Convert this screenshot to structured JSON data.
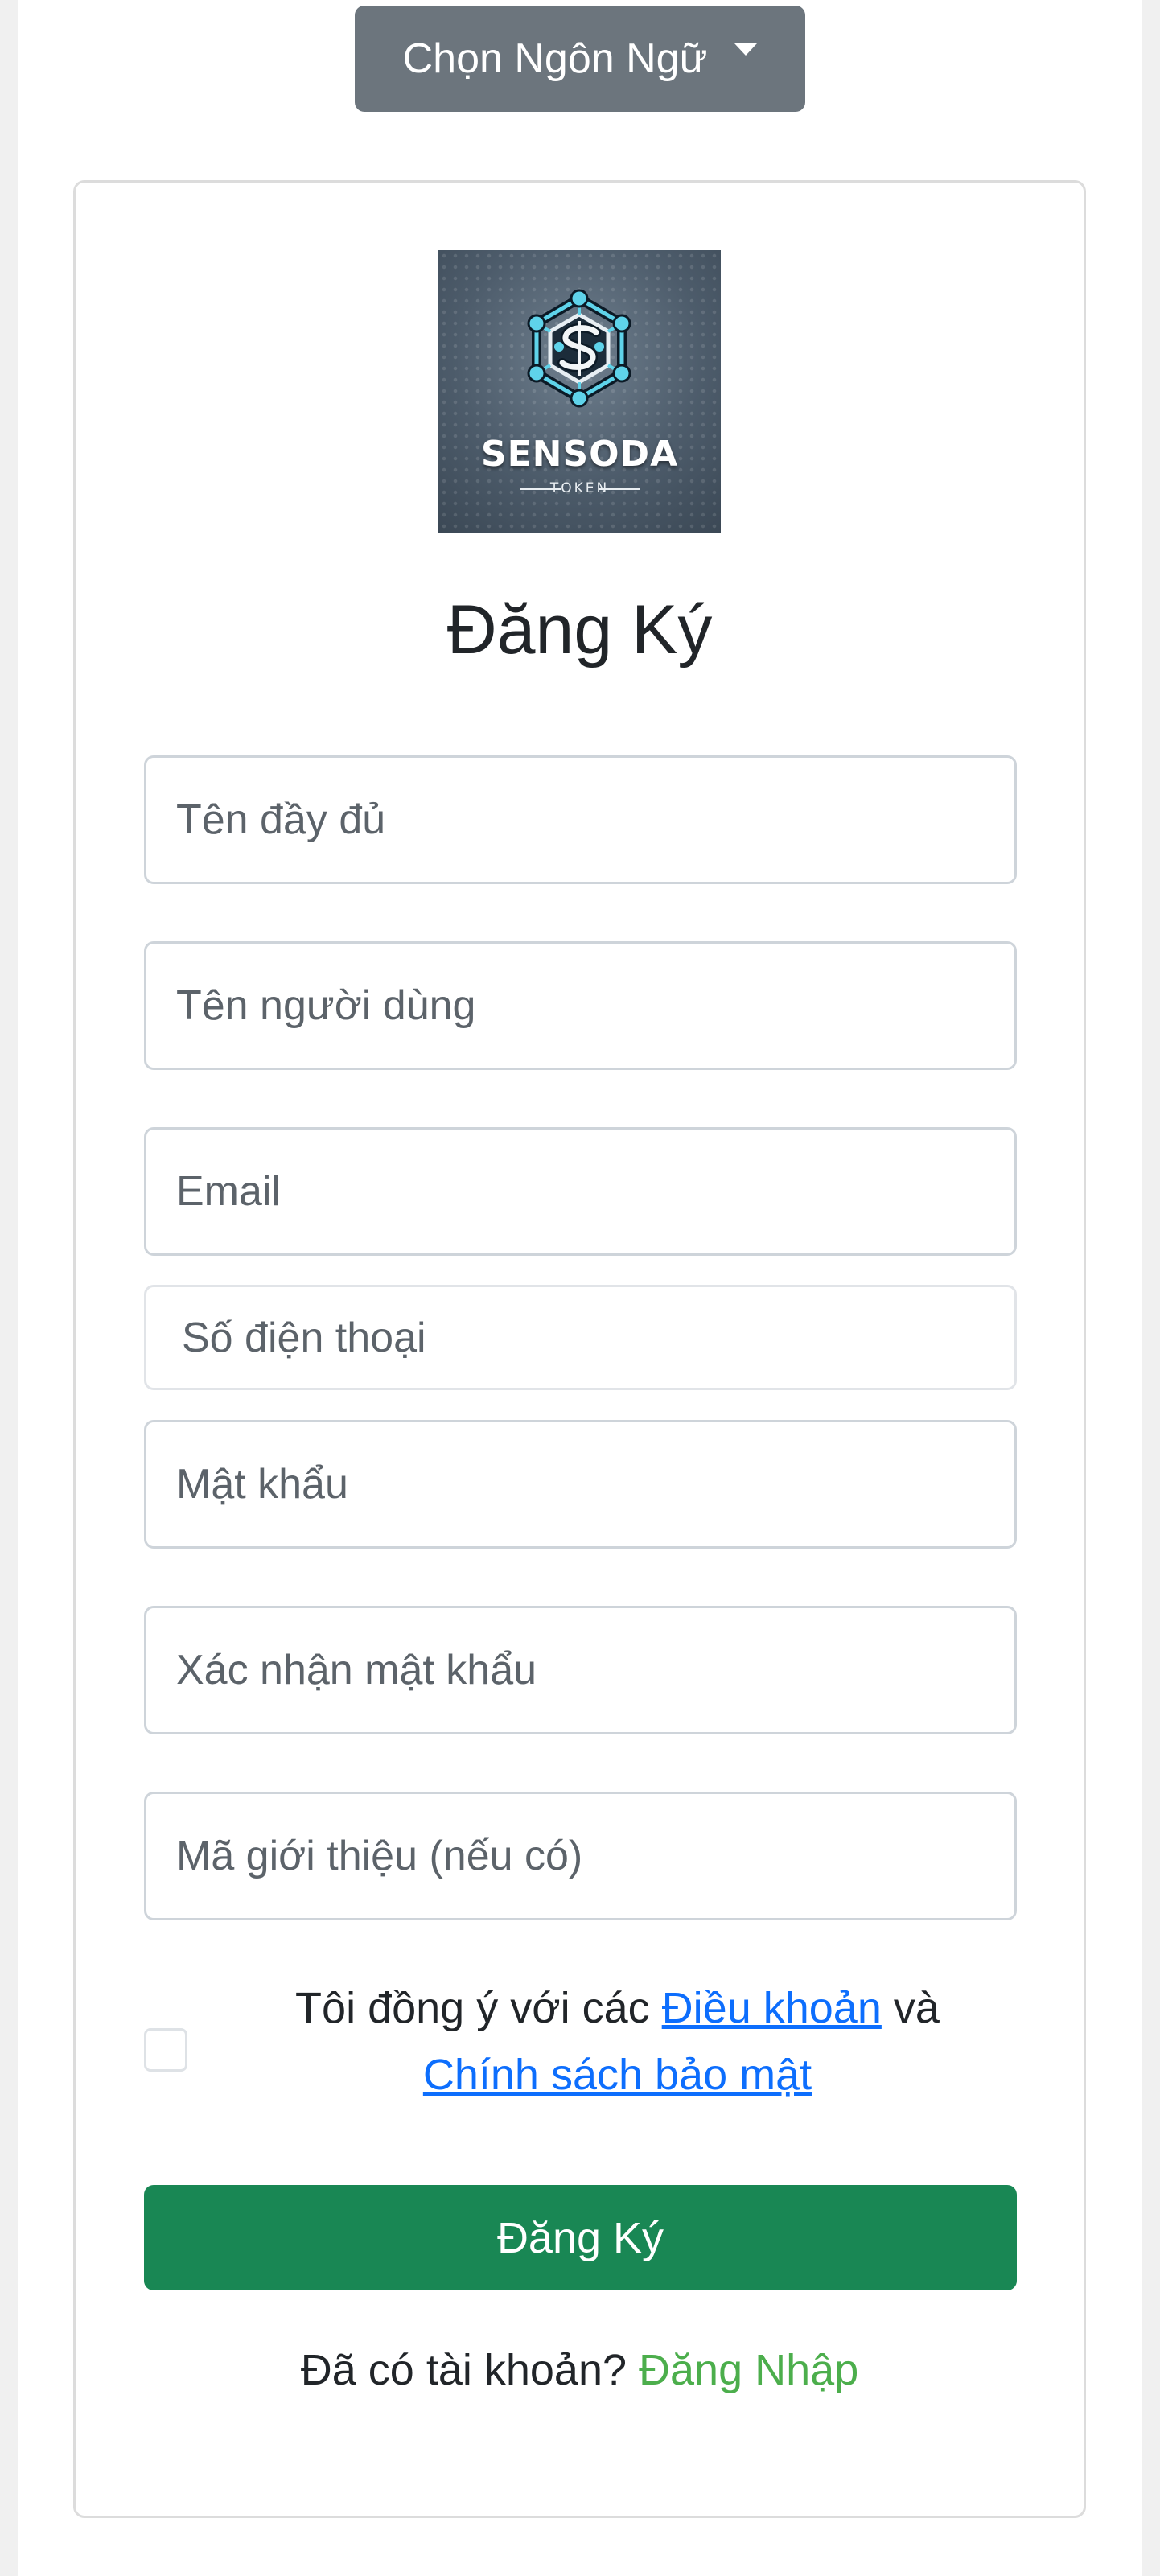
{
  "language_menu": {
    "label": "Chọn Ngôn Ngữ"
  },
  "logo": {
    "name": "SENSODA",
    "sub": "TOKEN"
  },
  "form": {
    "title": "Đăng Ký",
    "fields": {
      "full_name": {
        "placeholder": "Tên đầy đủ",
        "value": ""
      },
      "username": {
        "placeholder": "Tên người dùng",
        "value": ""
      },
      "email": {
        "placeholder": "Email",
        "value": ""
      },
      "phone": {
        "placeholder": "Số điện thoại",
        "value": ""
      },
      "password": {
        "placeholder": "Mật khẩu",
        "value": ""
      },
      "confirm_password": {
        "placeholder": "Xác nhận mật khẩu",
        "value": ""
      },
      "referral": {
        "placeholder": "Mã giới thiệu (nếu có)",
        "value": ""
      }
    },
    "terms": {
      "checked": false,
      "text_before": "Tôi đồng ý với các",
      "terms_link": "Điều khoản",
      "conjunction": "và",
      "privacy_link": "Chính sách bảo mật"
    },
    "submit_label": "Đăng Ký",
    "login_prompt": "Đã có tài khoản?",
    "login_link": "Đăng Nhập"
  },
  "colors": {
    "primary_button": "#198754",
    "dropdown_button": "#6c757d",
    "link": "#0d6efd",
    "login_link": "#4cae4c"
  }
}
